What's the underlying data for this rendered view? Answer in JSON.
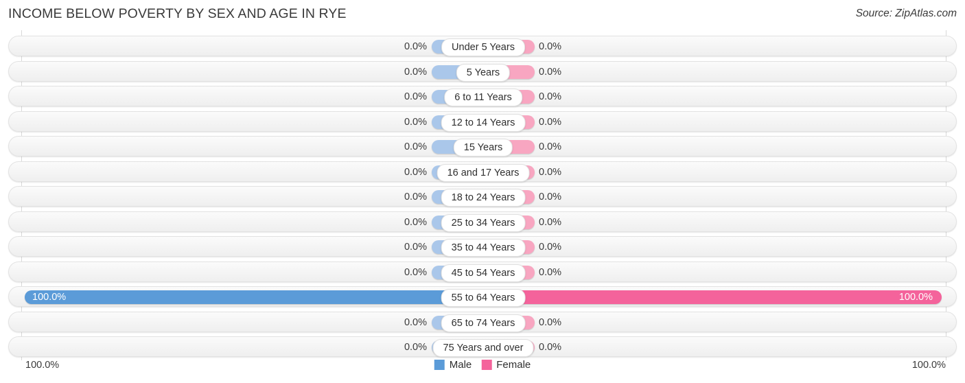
{
  "header": {
    "title": "INCOME BELOW POVERTY BY SEX AND AGE IN RYE",
    "source": "Source: ZipAtlas.com"
  },
  "legend": {
    "male_label": "Male",
    "female_label": "Female",
    "male_color": "#5b9bd8",
    "female_color": "#f4639b"
  },
  "axis": {
    "left_label": "100.0%",
    "right_label": "100.0%"
  },
  "colors": {
    "male_light": "#aac7ea",
    "female_light": "#f8a6c1",
    "male_strong": "#5b9bd8",
    "female_strong": "#f4639b",
    "track": "#f4f4f4",
    "text": "#3a3a3a"
  },
  "chart_data": {
    "type": "bar",
    "title": "INCOME BELOW POVERTY BY SEX AND AGE IN RYE",
    "subtitle": "",
    "xlabel": "",
    "ylabel": "",
    "orientation": "horizontal-diverging",
    "xlim": [
      0,
      100
    ],
    "grid": true,
    "legend_position": "bottom-center",
    "categories": [
      "Under 5 Years",
      "5 Years",
      "6 to 11 Years",
      "12 to 14 Years",
      "15 Years",
      "16 and 17 Years",
      "18 to 24 Years",
      "25 to 34 Years",
      "35 to 44 Years",
      "45 to 54 Years",
      "55 to 64 Years",
      "65 to 74 Years",
      "75 Years and over"
    ],
    "series": [
      {
        "name": "Male",
        "values": [
          0.0,
          0.0,
          0.0,
          0.0,
          0.0,
          0.0,
          0.0,
          0.0,
          0.0,
          0.0,
          100.0,
          0.0,
          0.0
        ],
        "labels": [
          "0.0%",
          "0.0%",
          "0.0%",
          "0.0%",
          "0.0%",
          "0.0%",
          "0.0%",
          "0.0%",
          "0.0%",
          "0.0%",
          "100.0%",
          "0.0%",
          "0.0%"
        ]
      },
      {
        "name": "Female",
        "values": [
          0.0,
          0.0,
          0.0,
          0.0,
          0.0,
          0.0,
          0.0,
          0.0,
          0.0,
          0.0,
          100.0,
          0.0,
          0.0
        ],
        "labels": [
          "0.0%",
          "0.0%",
          "0.0%",
          "0.0%",
          "0.0%",
          "0.0%",
          "0.0%",
          "0.0%",
          "0.0%",
          "0.0%",
          "100.0%",
          "0.0%",
          "0.0%"
        ]
      }
    ]
  }
}
